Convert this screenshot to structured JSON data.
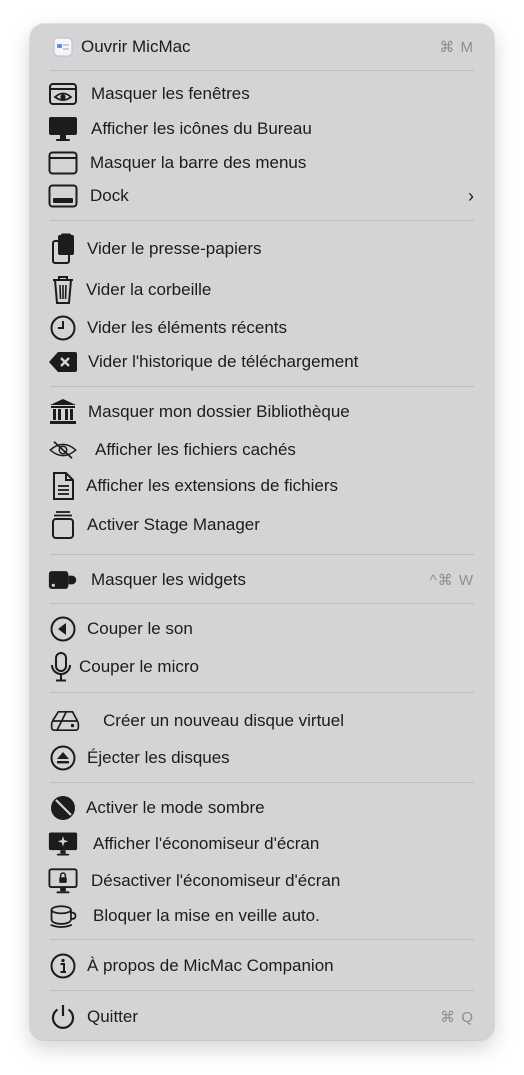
{
  "menu": {
    "open_app": {
      "label": "Ouvrir MicMac",
      "shortcut": "⌘ M"
    },
    "hide_windows": {
      "label": "Masquer les fenêtres"
    },
    "show_desktop_icons": {
      "label": "Afficher les icônes du Bureau"
    },
    "hide_menu_bar": {
      "label": "Masquer la barre des menus"
    },
    "dock": {
      "label": "Dock",
      "chevron": "›"
    },
    "clear_clipboard": {
      "label": "Vider le presse-papiers"
    },
    "empty_trash": {
      "label": "Vider la corbeille"
    },
    "clear_recents": {
      "label": "Vider les éléments récents"
    },
    "clear_downloads": {
      "label": "Vider l'historique de téléchargement"
    },
    "hide_library": {
      "label": "Masquer mon dossier Bibliothèque"
    },
    "show_hidden_files": {
      "label": "Afficher les fichiers cachés"
    },
    "show_extensions": {
      "label": "Afficher les extensions de fichiers"
    },
    "stage_manager": {
      "label": "Activer Stage Manager"
    },
    "hide_widgets": {
      "label": "Masquer les widgets",
      "shortcut": "^⌘ W"
    },
    "mute_sound": {
      "label": "Couper le son"
    },
    "mute_mic": {
      "label": "Couper le micro"
    },
    "new_ram_disk": {
      "label": "Créer un nouveau disque virtuel"
    },
    "eject_disks": {
      "label": "Éjecter les disques"
    },
    "dark_mode": {
      "label": "Activer le mode sombre"
    },
    "show_screensaver": {
      "label": "Afficher l'économiseur d'écran"
    },
    "disable_screensaver": {
      "label": "Désactiver l'économiseur d'écran"
    },
    "prevent_sleep": {
      "label": "Bloquer la mise en veille auto."
    },
    "about": {
      "label": "À propos de MicMac Companion"
    },
    "quit": {
      "label": "Quitter",
      "shortcut": "⌘ Q"
    }
  },
  "icons": {
    "open_app": "app-icon",
    "hide_windows": "eye-window-icon",
    "show_desktop_icons": "monitor-icon",
    "hide_menu_bar": "window-icon",
    "dock": "dock-icon",
    "clear_clipboard": "clipboard-icon",
    "empty_trash": "trash-icon",
    "clear_recents": "clock-icon",
    "clear_downloads": "delete-icon",
    "hide_library": "library-icon",
    "show_hidden_files": "eye-slash-icon",
    "show_extensions": "document-icon",
    "stage_manager": "stage-manager-icon",
    "hide_widgets": "widgets-icon",
    "mute_sound": "speaker-icon",
    "mute_mic": "microphone-icon",
    "new_ram_disk": "drive-icon",
    "eject_disks": "eject-icon",
    "dark_mode": "dark-mode-icon",
    "show_screensaver": "screensaver-icon",
    "disable_screensaver": "screen-lock-icon",
    "prevent_sleep": "coffee-cup-icon",
    "about": "info-icon",
    "quit": "power-icon"
  },
  "colors": {
    "menu_bg": "#d4d4d4",
    "text": "#1c1c1c",
    "shortcut": "#8e8e8e",
    "separator": "#bcbcbc"
  }
}
